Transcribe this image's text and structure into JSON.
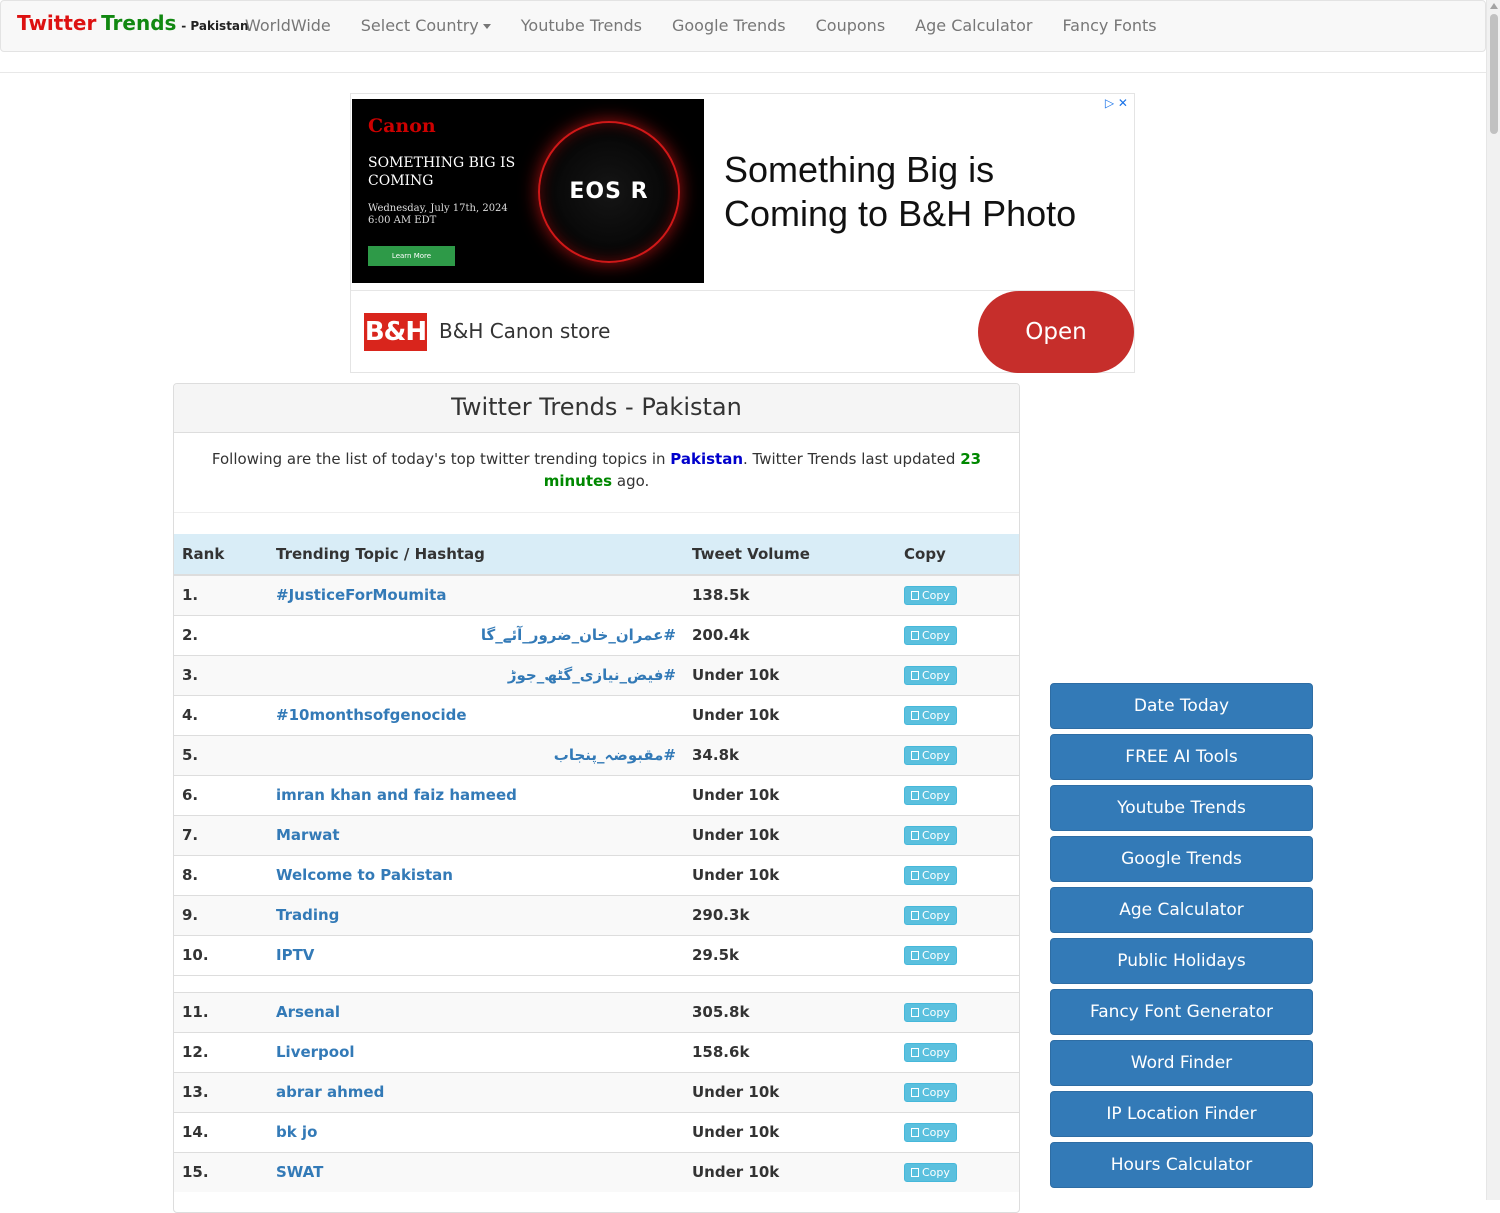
{
  "brand": {
    "part1": "Twitter",
    "part2": "Trends",
    "sub": "- Pakistan"
  },
  "nav": {
    "worldwide": "WorldWide",
    "select_country": "Select Country",
    "youtube": "Youtube Trends",
    "google": "Google Trends",
    "coupons": "Coupons",
    "age": "Age Calculator",
    "fancy": "Fancy Fonts"
  },
  "ad": {
    "brand": "Canon",
    "tagline": "SOMETHING BIG IS COMING",
    "date": "Wednesday, July 17th, 2024 6:00 AM EDT",
    "learn": "Learn More",
    "product": "EOS R",
    "headline": "Something Big is Coming to B&H Photo",
    "logo": "B&H",
    "store": "B&H Canon store",
    "open": "Open"
  },
  "panel": {
    "title": "Twitter Trends - Pakistan",
    "intro_pre": "Following are the list of today's top twitter trending topics in",
    "country": "Pakistan",
    "intro_mid": ". Twitter Trends last updated",
    "updated": "23 minutes",
    "intro_post": "ago."
  },
  "table": {
    "headers": {
      "rank": "Rank",
      "topic": "Trending Topic / Hashtag",
      "volume": "Tweet Volume",
      "copy": "Copy"
    },
    "copy_label": "Copy",
    "rows": [
      {
        "rank": "1.",
        "topic": "#JusticeForMoumita",
        "volume": "138.5k"
      },
      {
        "rank": "2.",
        "topic": "#عمران_خان_ضرور_آئے_گا",
        "volume": "200.4k"
      },
      {
        "rank": "3.",
        "topic": "#فیض_نیازی_گٹھ_جوڑ",
        "volume": "Under 10k"
      },
      {
        "rank": "4.",
        "topic": "#10monthsofgenocide",
        "volume": "Under 10k"
      },
      {
        "rank": "5.",
        "topic": "#مقبوضہ_پنجاب",
        "volume": "34.8k"
      },
      {
        "rank": "6.",
        "topic": "imran khan and faiz hameed",
        "volume": "Under 10k"
      },
      {
        "rank": "7.",
        "topic": "Marwat",
        "volume": "Under 10k"
      },
      {
        "rank": "8.",
        "topic": "Welcome to Pakistan",
        "volume": "Under 10k"
      },
      {
        "rank": "9.",
        "topic": "Trading",
        "volume": "290.3k"
      },
      {
        "rank": "10.",
        "topic": "IPTV",
        "volume": "29.5k"
      },
      {
        "rank": "11.",
        "topic": "Arsenal",
        "volume": "305.8k"
      },
      {
        "rank": "12.",
        "topic": "Liverpool",
        "volume": "158.6k"
      },
      {
        "rank": "13.",
        "topic": "abrar ahmed",
        "volume": "Under 10k"
      },
      {
        "rank": "14.",
        "topic": "bk jo",
        "volume": "Under 10k"
      },
      {
        "rank": "15.",
        "topic": "SWAT",
        "volume": "Under 10k"
      }
    ]
  },
  "sidebar": {
    "items": [
      "Date Today",
      "FREE AI Tools",
      "Youtube Trends",
      "Google Trends",
      "Age Calculator",
      "Public Holidays",
      "Fancy Font Generator",
      "Word Finder",
      "IP Location Finder",
      "Hours Calculator"
    ]
  }
}
